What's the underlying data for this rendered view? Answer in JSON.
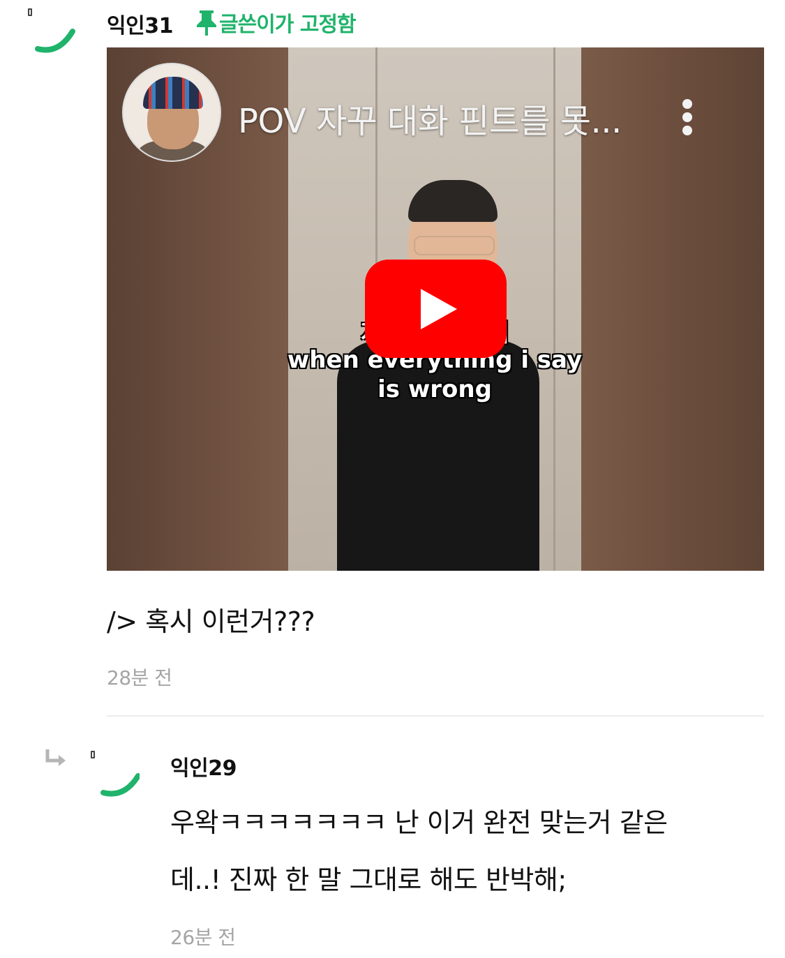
{
  "comment1": {
    "username": "익인31",
    "pin_label": "글쓴이가 고정함",
    "video": {
      "title": "POV 자꾸 대화 핀트를 못...",
      "caption_lines": [
        "자꾸 대          잡을때",
        "when everything i say",
        "is wrong"
      ]
    },
    "text": "/> 혹시 이런거???",
    "time": "28분 전"
  },
  "reply1": {
    "username": "익인29",
    "text_line1": "우왁ㅋㅋㅋㅋㅋㅋㅋ 난 이거 완전 맞는거 같은",
    "text_line2": "데..! 진짜 한 말 그대로 해도 반박해;",
    "time": "26분 전"
  },
  "colors": {
    "accent_green": "#20b36b",
    "youtube_red": "#ff0000",
    "time_gray": "#a5a5a5"
  },
  "icons": [
    "avatar-icon",
    "pin-icon",
    "more-vert-icon",
    "play-icon",
    "reply-arrow-icon"
  ]
}
